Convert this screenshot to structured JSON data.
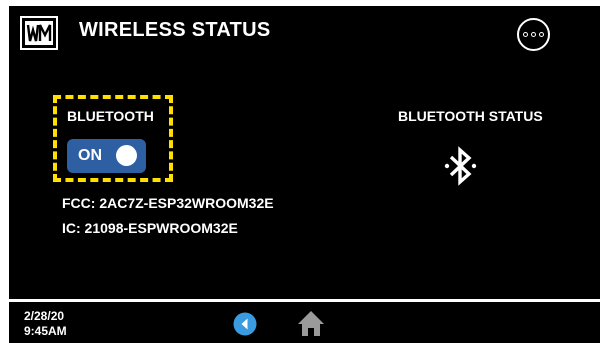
{
  "header": {
    "logo_icon": "wm-logo-icon",
    "title": "WIRELESS STATUS",
    "more_icon": "more-options-icon"
  },
  "bluetooth": {
    "label": "BLUETOOTH",
    "toggle_state": "ON",
    "frame_color": "#ffe000",
    "toggle_color": "#2f5fa3"
  },
  "ids": {
    "fcc": "FCC: 2AC7Z-ESP32WROOM32E",
    "ic": "IC: 21098-ESPWROOM32E"
  },
  "status": {
    "label": "BLUETOOTH STATUS",
    "icon": "bluetooth-icon"
  },
  "footer": {
    "date": "2/28/20",
    "time": "9:45AM",
    "back_icon": "back-icon",
    "home_icon": "home-icon",
    "back_color": "#3a9be0"
  }
}
